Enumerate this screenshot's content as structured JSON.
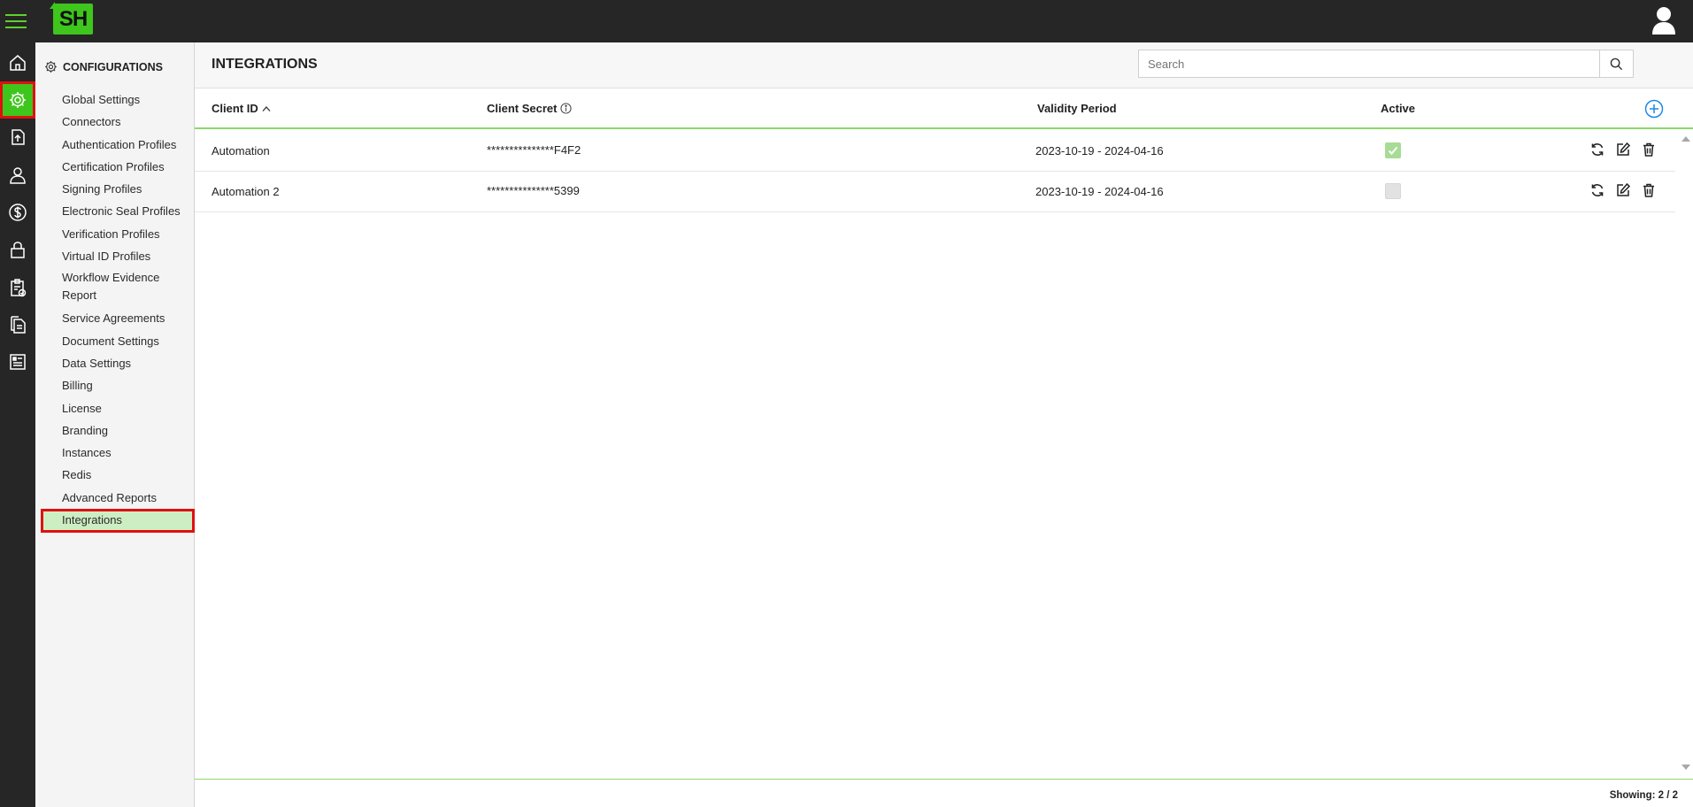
{
  "topbar": {
    "logo_text": "SH"
  },
  "rail": {
    "items": [
      {
        "icon": "home-icon"
      },
      {
        "icon": "gear-icon",
        "active": true
      },
      {
        "icon": "upload-icon"
      },
      {
        "icon": "users-icon"
      },
      {
        "icon": "dollar-icon"
      },
      {
        "icon": "lock-icon"
      },
      {
        "icon": "clipboard-check-icon"
      },
      {
        "icon": "documents-icon"
      },
      {
        "icon": "report-icon"
      }
    ]
  },
  "sidebar": {
    "header": "CONFIGURATIONS",
    "items": [
      {
        "label": "Global Settings"
      },
      {
        "label": "Connectors"
      },
      {
        "label": "Authentication Profiles"
      },
      {
        "label": "Certification Profiles"
      },
      {
        "label": "Signing Profiles"
      },
      {
        "label": "Electronic Seal Profiles"
      },
      {
        "label": "Verification Profiles"
      },
      {
        "label": "Virtual ID Profiles"
      },
      {
        "label": "Workflow Evidence Report"
      },
      {
        "label": "Service Agreements"
      },
      {
        "label": "Document Settings"
      },
      {
        "label": "Data Settings"
      },
      {
        "label": "Billing"
      },
      {
        "label": "License"
      },
      {
        "label": "Branding"
      },
      {
        "label": "Instances"
      },
      {
        "label": "Redis"
      },
      {
        "label": "Advanced Reports"
      },
      {
        "label": "Integrations",
        "selected": true
      }
    ]
  },
  "main": {
    "title": "INTEGRATIONS",
    "search": {
      "placeholder": "Search",
      "value": ""
    },
    "columns": {
      "client_id": "Client ID",
      "client_secret": "Client Secret",
      "validity": "Validity Period",
      "active": "Active"
    },
    "rows": [
      {
        "client_id": "Automation",
        "client_secret": "***************F4F2",
        "validity": "2023-10-19 - 2024-04-16",
        "active": true
      },
      {
        "client_id": "Automation 2",
        "client_secret": "***************5399",
        "validity": "2023-10-19 - 2024-04-16",
        "active": false
      }
    ],
    "showing": "Showing: 2 / 2"
  },
  "colors": {
    "accent": "#3ec61c",
    "highlight": "#e01010",
    "rail_bg": "#262626",
    "selected_bg": "#cdeec2"
  }
}
